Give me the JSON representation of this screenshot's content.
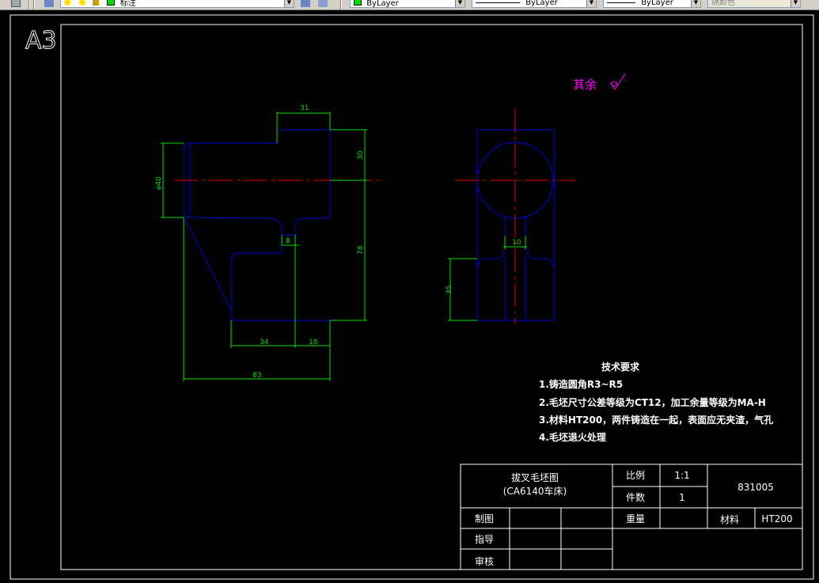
{
  "toolbar": {
    "layer_name": "标注",
    "color": "ByLayer",
    "linetype": "ByLayer",
    "lineweight": "ByLayer",
    "plotstyle": "随颜色"
  },
  "sheet": {
    "size_label": "A3"
  },
  "roughness": {
    "label": "其余"
  },
  "dimensions": {
    "d31": "31",
    "d30": "30",
    "d40": "⌀40",
    "d8": "8",
    "d78": "78",
    "d34": "34",
    "d18": "18",
    "d83": "83",
    "d10": "10",
    "d35": "35"
  },
  "tech_requirements": {
    "title": "技术要求",
    "items": [
      "1.铸造圆角R3~R5",
      "2.毛坯尺寸公差等级为CT12，加工余量等级为MA-H",
      "3.材料HT200，两件铸造在一起，表面应无夹渣，气孔",
      "4.毛坯退火处理"
    ]
  },
  "title_block": {
    "name": "拔叉毛坯图",
    "machine": "(CA6140车床)",
    "scale_label": "比例",
    "scale_value": "1:1",
    "qty_label": "件数",
    "qty_value": "1",
    "drawing_no": "831005",
    "drawn_label": "制图",
    "weight_label": "重量",
    "material_label": "材料",
    "material_value": "HT200",
    "guide_label": "指导",
    "review_label": "审核"
  },
  "colors": {
    "outline": "#0000d8",
    "dimension": "#00e000",
    "centerline": "#e00000",
    "annotation": "#ff00ff",
    "text": "#ffffff",
    "frame": "#ffffff",
    "background": "#000000"
  }
}
